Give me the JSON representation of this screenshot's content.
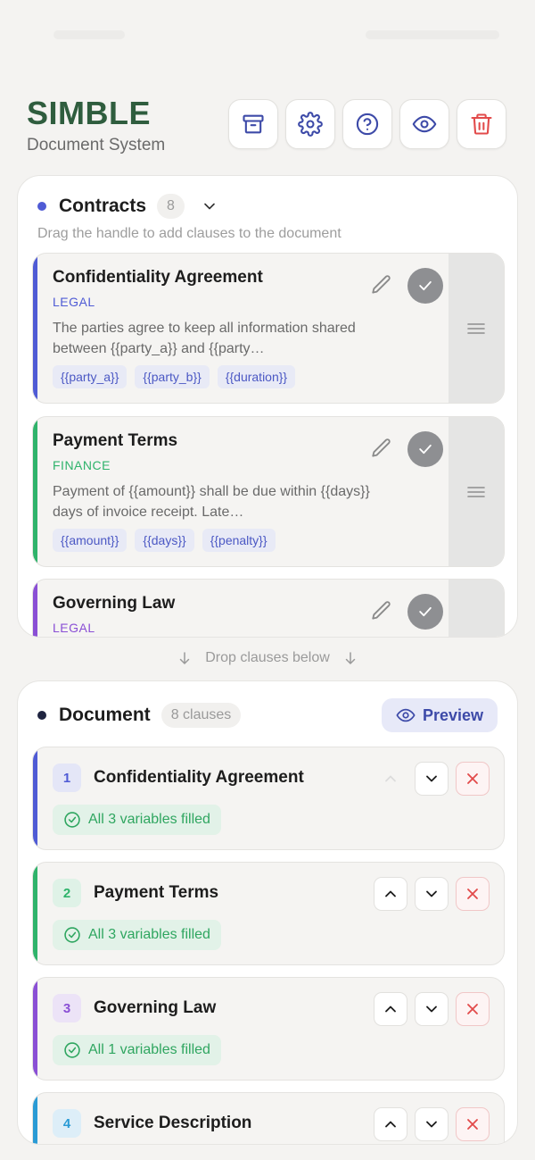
{
  "brand": {
    "title": "SIMBLE",
    "subtitle": "Document System"
  },
  "toolbar": [
    {
      "icon": "archive-icon"
    },
    {
      "icon": "gear-icon"
    },
    {
      "icon": "help-icon"
    },
    {
      "icon": "eye-icon"
    },
    {
      "icon": "trash-icon"
    }
  ],
  "contracts": {
    "title": "Contracts",
    "count": "8",
    "hint": "Drag the handle to add clauses to the document",
    "dot_color": "#4f5bd5",
    "clauses": [
      {
        "title": "Confidentiality Agreement",
        "category": "LEGAL",
        "category_color": "#4f5bd5",
        "accent": "#4f5bd5",
        "body_line1": "The parties agree to keep all information shared",
        "body_line2": "between {{party_a}} and {{party…",
        "tags": [
          "{{party_a}}",
          "{{party_b}}",
          "{{duration}}"
        ]
      },
      {
        "title": "Payment Terms",
        "category": "FINANCE",
        "category_color": "#2fb36b",
        "accent": "#2fb36b",
        "body_line1": "Payment of {{amount}} shall be due within {{days}}",
        "body_line2": "days of invoice receipt. Late…",
        "tags": [
          "{{amount}}",
          "{{days}}",
          "{{penalty}}"
        ]
      },
      {
        "title": "Governing Law",
        "category": "LEGAL",
        "category_color": "#8a4fd5",
        "accent": "#8a4fd5"
      }
    ]
  },
  "drop_hint": "Drop clauses below",
  "document": {
    "title": "Document",
    "count": "8 clauses",
    "preview_label": "Preview",
    "dot_color": "#1f2440",
    "items": [
      {
        "num": "1",
        "title": "Confidentiality Agreement",
        "status": "All 3 variables filled",
        "accent": "#4f5bd5",
        "badge_bg": "#e4e6f7",
        "badge_fg": "#4f5bd5"
      },
      {
        "num": "2",
        "title": "Payment Terms",
        "status": "All 3 variables filled",
        "accent": "#2fb36b",
        "badge_bg": "#dff2e7",
        "badge_fg": "#2fb36b"
      },
      {
        "num": "3",
        "title": "Governing Law",
        "status": "All 1 variables filled",
        "accent": "#8a4fd5",
        "badge_bg": "#ece3f7",
        "badge_fg": "#8a4fd5"
      },
      {
        "num": "4",
        "title": "Service Description",
        "accent": "#2a9bd5",
        "badge_bg": "#ddeef8",
        "badge_fg": "#2a9bd5"
      }
    ]
  }
}
